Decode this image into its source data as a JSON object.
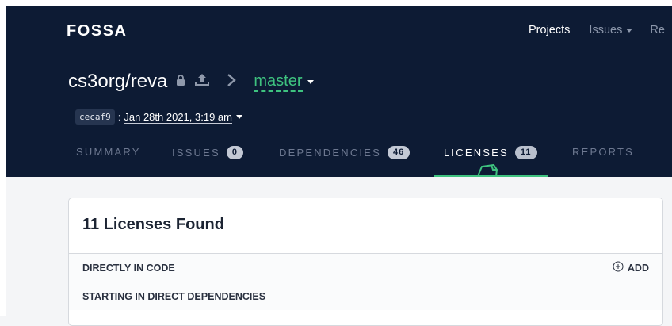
{
  "brand": "FOSSA",
  "top_nav": {
    "projects": "Projects",
    "issues": "Issues",
    "reports": "Re"
  },
  "repo": {
    "name": "cs3org/reva",
    "branch": "master",
    "commit": "cecaf9",
    "commit_separator": ":",
    "date": "Jan 28th 2021, 3:19 am"
  },
  "tabs": [
    {
      "label": "SUMMARY"
    },
    {
      "label": "ISSUES",
      "count": "0"
    },
    {
      "label": "DEPENDENCIES",
      "count": "46"
    },
    {
      "label": "LICENSES",
      "count": "11",
      "active": true
    },
    {
      "label": "REPORTS"
    }
  ],
  "card": {
    "title": "11 Licenses Found",
    "sections": [
      {
        "label": "DIRECTLY IN CODE",
        "action": "ADD"
      },
      {
        "label": "STARTING IN DIRECT DEPENDENCIES"
      }
    ]
  },
  "colors": {
    "header_bg": "#0d1b34",
    "accent_green": "#3ec27f",
    "badge": "#c3c9d5"
  },
  "icons": [
    "lock-icon",
    "upload-icon",
    "chevron-right-icon",
    "chevron-down-icon",
    "document-tab-icon",
    "plus-circle-icon"
  ]
}
